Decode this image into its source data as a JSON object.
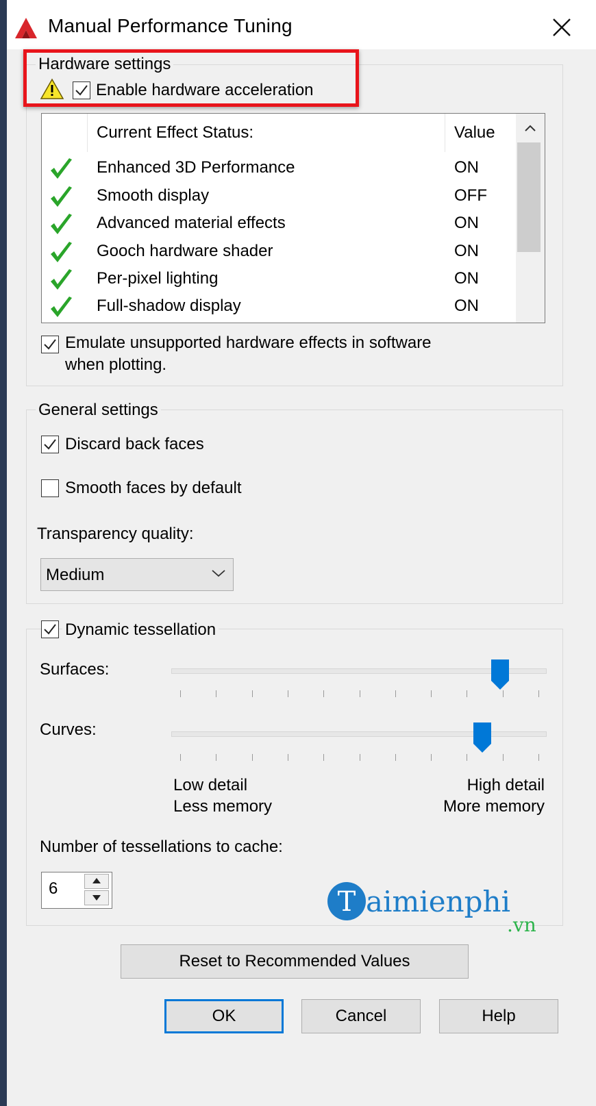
{
  "window": {
    "title": "Manual Performance Tuning",
    "icon": "autocad-icon",
    "close_icon": "close-icon"
  },
  "hardware": {
    "legend": "Hardware settings",
    "enable_accel_label": "Enable hardware acceleration",
    "enable_accel_checked": true,
    "warning_icon": "warning-icon",
    "list": {
      "header_status": "Current Effect Status:",
      "header_value": "Value",
      "rows": [
        {
          "effect": "Enhanced 3D Performance",
          "value": "ON",
          "status_icon": "green-check-icon"
        },
        {
          "effect": "Smooth display",
          "value": "OFF",
          "status_icon": "green-check-icon"
        },
        {
          "effect": "Advanced material effects",
          "value": "ON",
          "status_icon": "green-check-icon"
        },
        {
          "effect": "Gooch hardware shader",
          "value": "ON",
          "status_icon": "green-check-icon"
        },
        {
          "effect": "Per-pixel lighting",
          "value": "ON",
          "status_icon": "green-check-icon"
        },
        {
          "effect": "Full-shadow display",
          "value": "ON",
          "status_icon": "green-check-icon"
        }
      ]
    },
    "emulate_label_line1": "Emulate unsupported hardware effects in software",
    "emulate_label_line2": "when plotting.",
    "emulate_checked": true
  },
  "general": {
    "legend": "General settings",
    "discard_back_faces_label": "Discard back faces",
    "discard_back_faces_checked": true,
    "smooth_faces_label": "Smooth faces by default",
    "smooth_faces_checked": false,
    "transparency_label": "Transparency quality:",
    "transparency_value": "Medium"
  },
  "tessellation": {
    "legend": "Dynamic tessellation",
    "enabled": true,
    "surfaces_label": "Surfaces:",
    "surfaces_level": 0.9,
    "curves_label": "Curves:",
    "curves_level": 0.85,
    "low_detail": "Low detail",
    "less_memory": "Less memory",
    "high_detail": "High detail",
    "more_memory": "More memory",
    "cache_label": "Number of tessellations to cache:",
    "cache_value": "6"
  },
  "watermark": {
    "brand": "aimienphi",
    "brand_initial": "T",
    "suffix": ".vn"
  },
  "buttons": {
    "reset": "Reset to Recommended Values",
    "ok": "OK",
    "cancel": "Cancel",
    "help": "Help"
  },
  "colors": {
    "highlight": "#e8141b",
    "check_green": "#2aa52a",
    "slider_thumb": "#0078d7",
    "accent": "#0078d7"
  }
}
